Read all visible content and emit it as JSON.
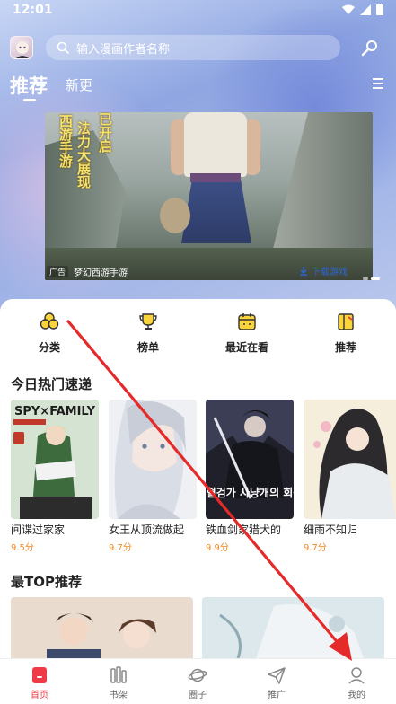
{
  "status_bar": {
    "time": "12:01"
  },
  "header": {
    "search_placeholder": "输入漫画作者名称",
    "tabs": [
      {
        "label": "推荐"
      },
      {
        "label": "新更"
      }
    ]
  },
  "banner": {
    "text_lines": [
      "西游手游",
      "法力大展现",
      "已开启"
    ],
    "ad_tag": "广告",
    "ad_name": "梦幻西游手游",
    "ad_action": "下载游戏"
  },
  "quick_nav": [
    {
      "label": "分类",
      "icon": "grid-circles-icon"
    },
    {
      "label": "榜单",
      "icon": "trophy-icon"
    },
    {
      "label": "最近在看",
      "icon": "calendar-icon"
    },
    {
      "label": "推荐",
      "icon": "book-icon"
    }
  ],
  "hot_section": {
    "title": "今日热门速递",
    "items": [
      {
        "title": "间谍过家家",
        "score": "9.5分",
        "cover_text": "SPY×FAMILY"
      },
      {
        "title": "女王从顶流做起",
        "score": "9.7分"
      },
      {
        "title": "铁血剑家猎犬的",
        "score": "9.9分",
        "cover_text": "철혈검가 사냥개의 회귀"
      },
      {
        "title": "细雨不知归",
        "score": "9.7分"
      }
    ]
  },
  "top_section": {
    "title": "最TOP推荐"
  },
  "bottom_nav": [
    {
      "label": "首页",
      "icon": "home-icon",
      "active": true
    },
    {
      "label": "书架",
      "icon": "bookshelf-icon",
      "active": false
    },
    {
      "label": "圈子",
      "icon": "planet-icon",
      "active": false
    },
    {
      "label": "推广",
      "icon": "send-icon",
      "active": false
    },
    {
      "label": "我的",
      "icon": "user-icon",
      "active": false
    }
  ],
  "colors": {
    "accent": "#ef3a47",
    "score": "#f08a24",
    "annotation": "#e52a2a"
  }
}
